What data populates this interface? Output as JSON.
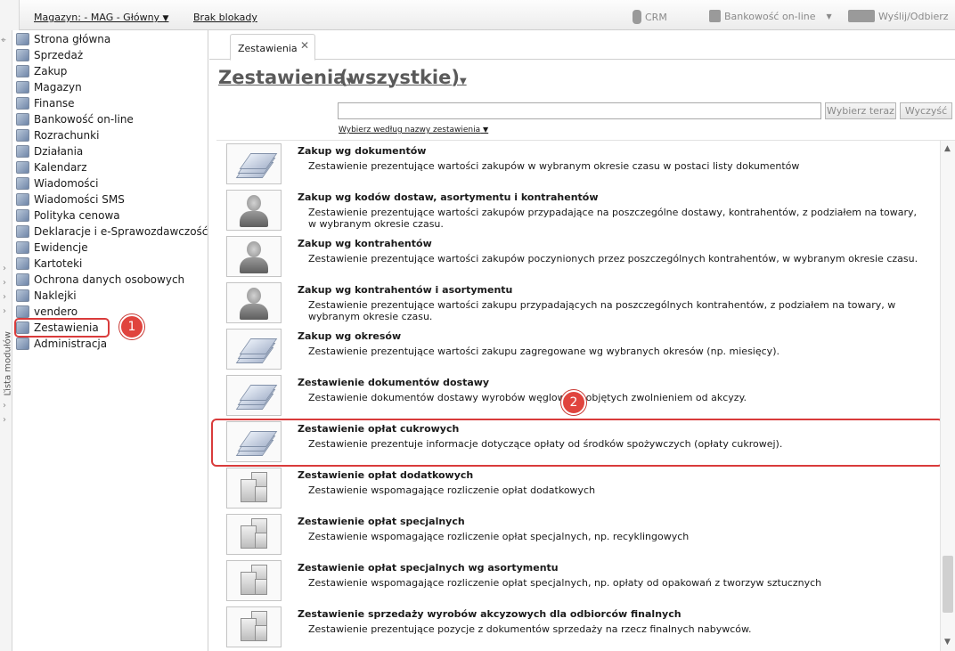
{
  "topbar": {
    "magazine": "Magazyn: - MAG - Główny",
    "lock": "Brak blokady",
    "crm": "CRM",
    "bank": "Bankowość on-line",
    "send": "Wyślij/Odbierz"
  },
  "vstrip": {
    "label": "Lista modułów"
  },
  "sidebar": {
    "items": [
      {
        "label": "Strona główna"
      },
      {
        "label": "Sprzedaż"
      },
      {
        "label": "Zakup"
      },
      {
        "label": "Magazyn"
      },
      {
        "label": "Finanse"
      },
      {
        "label": "Bankowość on-line"
      },
      {
        "label": "Rozrachunki"
      },
      {
        "label": "Działania"
      },
      {
        "label": "Kalendarz"
      },
      {
        "label": "Wiadomości"
      },
      {
        "label": "Wiadomości SMS"
      },
      {
        "label": "Polityka cenowa"
      },
      {
        "label": "Deklaracje i e-Sprawozdawczość"
      },
      {
        "label": "Ewidencje"
      },
      {
        "label": "Kartoteki"
      },
      {
        "label": "Ochrona danych osobowych"
      },
      {
        "label": "Naklejki"
      },
      {
        "label": "vendero"
      },
      {
        "label": "Zestawienia",
        "active": true
      },
      {
        "label": "Administracja"
      }
    ]
  },
  "annotations": {
    "badge1": "1",
    "badge2": "2"
  },
  "main": {
    "tab_label": "Zestawienia",
    "heading1": "Zestawienia",
    "heading2": "(wszystkie)",
    "search_value": "",
    "btn_choose": "Wybierz teraz",
    "btn_clear": "Wyczyść",
    "sort_label": "Wybierz według nazwy zestawienia"
  },
  "reports": [
    {
      "title": "Zakup wg dokumentów",
      "desc": "Zestawienie prezentujące wartości zakupów w wybranym okresie czasu w postaci listy dokumentów",
      "icon": "sheets-icon"
    },
    {
      "title": "Zakup wg kodów dostaw, asortymentu i kontrahentów",
      "desc": "Zestawienie prezentujące wartości zakupów przypadające na poszczególne dostawy, kontrahentów, z podziałem na towary, w wybranym okresie czasu.",
      "icon": "person-icon"
    },
    {
      "title": "Zakup wg kontrahentów",
      "desc": "Zestawienie prezentujące wartości zakupów poczynionych przez poszczególnych kontrahentów, w wybranym okresie czasu.",
      "icon": "person-icon"
    },
    {
      "title": "Zakup wg kontrahentów i asortymentu",
      "desc": "Zestawienie prezentujące wartości zakupu przypadających na poszczególnych kontrahentów, z podziałem na towary, w wybranym okresie czasu.",
      "icon": "person-icon"
    },
    {
      "title": "Zakup wg okresów",
      "desc": "Zestawienie prezentujące wartości zakupu zagregowane wg wybranych okresów (np. miesięcy).",
      "icon": "sheets-icon"
    },
    {
      "title": "Zestawienie dokumentów dostawy",
      "desc": "Zestawienie dokumentów dostawy wyrobów węglowych objętych zwolnieniem od akcyzy.",
      "icon": "sheets-icon"
    },
    {
      "title": "Zestawienie opłat cukrowych",
      "desc": "Zestawienie prezentuje informacje dotyczące opłaty od środków spożywczych (opłaty cukrowej).",
      "icon": "sheets-icon"
    },
    {
      "title": "Zestawienie opłat dodatkowych",
      "desc": "Zestawienie wspomagające rozliczenie opłat dodatkowych",
      "icon": "boxes-icon"
    },
    {
      "title": "Zestawienie opłat specjalnych",
      "desc": "Zestawienie wspomagające rozliczenie opłat specjalnych, np. recyklingowych",
      "icon": "boxes-icon"
    },
    {
      "title": "Zestawienie opłat specjalnych wg asortymentu",
      "desc": "Zestawienie wspomagające rozliczenie opłat specjalnych, np. opłaty od opakowań z tworzyw sztucznych",
      "icon": "boxes-icon"
    },
    {
      "title": "Zestawienie sprzedaży wyrobów akcyzowych dla odbiorców finalnych",
      "desc": "Zestawienie prezentujące pozycje z dokumentów sprzedaży na rzecz finalnych nabywców.",
      "icon": "boxes-icon"
    }
  ],
  "colors": {
    "highlight": "#d93b3b",
    "badge": "#e0443e"
  }
}
